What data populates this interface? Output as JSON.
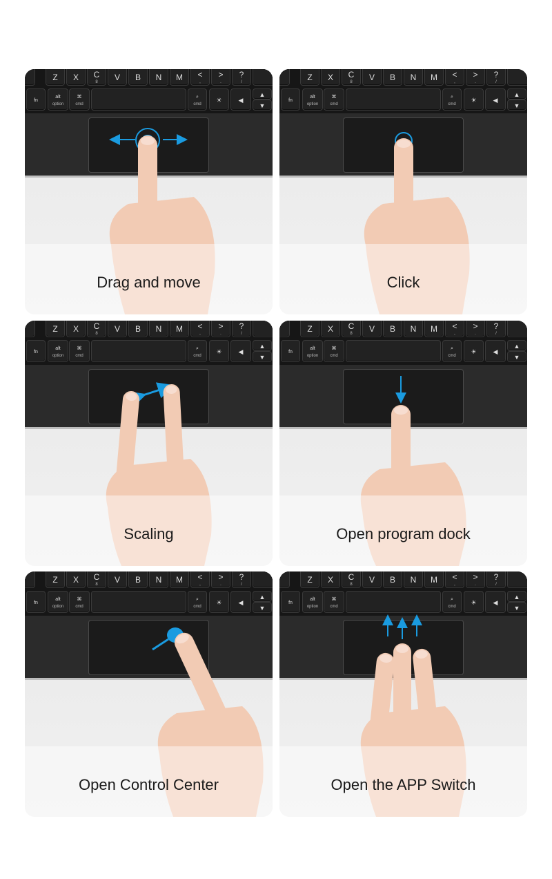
{
  "colors": {
    "accent": "#1a9be0",
    "skin": "#f2cbb4",
    "keyboard": "#2b2b2b",
    "trackpad": "#1b1b1b"
  },
  "keyboard": {
    "row1": [
      {
        "m": ""
      },
      {
        "m": "Z"
      },
      {
        "m": "X"
      },
      {
        "m": "C",
        "s": "8"
      },
      {
        "m": "V"
      },
      {
        "m": "B"
      },
      {
        "m": "N"
      },
      {
        "m": "M"
      },
      {
        "m": "<",
        "s": ","
      },
      {
        "m": ">",
        "s": "."
      },
      {
        "m": "?",
        "s": "/"
      },
      {
        "m": ""
      }
    ],
    "row2": [
      {
        "m": "fn"
      },
      {
        "m": "alt",
        "s": "option"
      },
      {
        "m": "⌘",
        "s": "cmd"
      },
      {
        "m": ""
      },
      {
        "m": "⌕",
        "s": "cmd"
      },
      {
        "m": "☀"
      },
      {
        "m": "◀"
      },
      {
        "m": "▲"
      },
      {
        "m": "▼"
      }
    ]
  },
  "cards": [
    {
      "caption": "Drag and move",
      "gesture": "drag"
    },
    {
      "caption": "Click",
      "gesture": "click"
    },
    {
      "caption": "Scaling",
      "gesture": "scale"
    },
    {
      "caption": "Open program dock",
      "gesture": "dock"
    },
    {
      "caption": "Open Control Center",
      "gesture": "control"
    },
    {
      "caption": "Open the APP Switch",
      "gesture": "appswitch"
    }
  ]
}
